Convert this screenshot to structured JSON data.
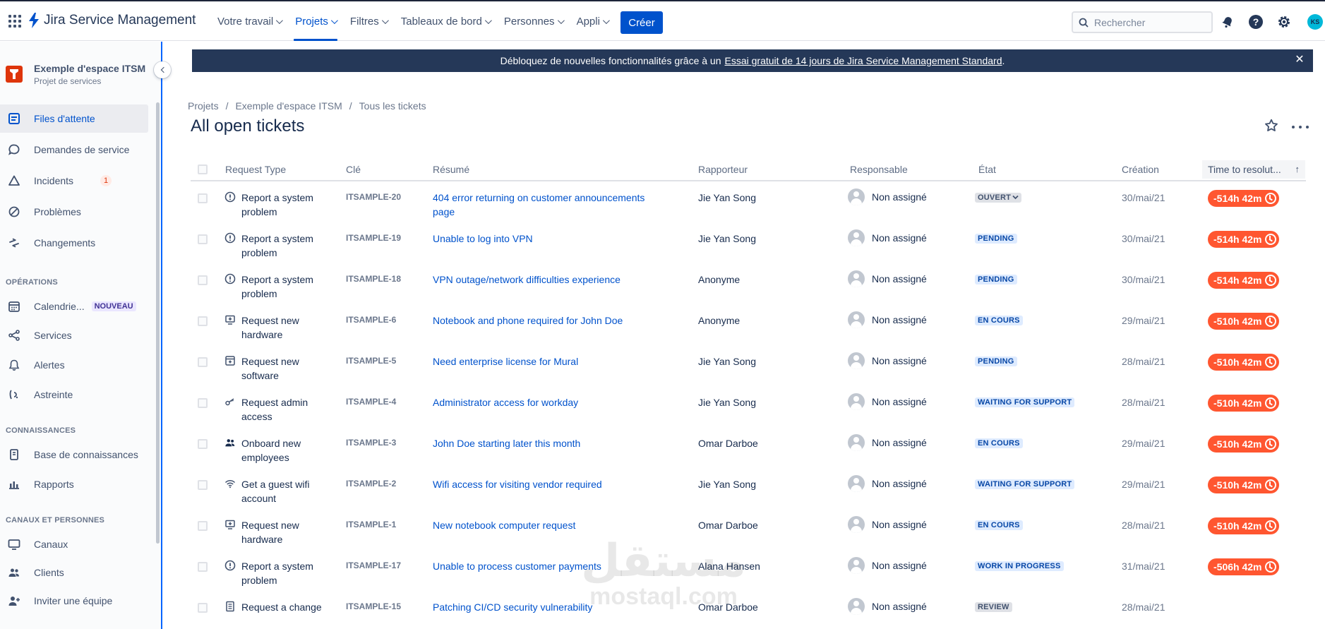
{
  "topnav": {
    "brand": "Jira Service Management",
    "menu": [
      {
        "label": "Votre travail",
        "active": false
      },
      {
        "label": "Projets",
        "active": true
      },
      {
        "label": "Filtres",
        "active": false
      },
      {
        "label": "Tableaux de bord",
        "active": false
      },
      {
        "label": "Personnes",
        "active": false
      },
      {
        "label": "Appli",
        "active": false
      }
    ],
    "create_label": "Créer",
    "search_placeholder": "Rechercher",
    "avatar_initials": "KS",
    "icons": [
      "app-switcher-icon",
      "notifications-icon",
      "help-icon",
      "settings-icon"
    ]
  },
  "sidebar": {
    "project_name": "Exemple d'espace ITSM",
    "project_type": "Projet de services",
    "items": [
      {
        "label": "Files d'attente",
        "icon": "queues-icon",
        "active": true
      },
      {
        "label": "Demandes de service",
        "icon": "chat-icon"
      },
      {
        "label": "Incidents",
        "icon": "warning-icon",
        "badge": "1"
      },
      {
        "label": "Problèmes",
        "icon": "prohibited-icon"
      },
      {
        "label": "Changements",
        "icon": "changes-icon"
      }
    ],
    "operations_title": "OPÉRATIONS",
    "operations": [
      {
        "label": "Calendrie...",
        "icon": "calendar-icon",
        "tag": "NOUVEAU"
      },
      {
        "label": "Services",
        "icon": "services-icon"
      },
      {
        "label": "Alertes",
        "icon": "bell-icon"
      },
      {
        "label": "Astreinte",
        "icon": "on-call-icon"
      }
    ],
    "knowledge_title": "CONNAISSANCES",
    "knowledge": [
      {
        "label": "Base de connaissances",
        "icon": "book-icon"
      },
      {
        "label": "Rapports",
        "icon": "chart-icon"
      }
    ],
    "channels_title": "CANAUX ET PERSONNES",
    "channels": [
      {
        "label": "Canaux",
        "icon": "monitor-icon"
      },
      {
        "label": "Clients",
        "icon": "people-icon"
      },
      {
        "label": "Inviter une équipe",
        "icon": "invite-icon"
      }
    ]
  },
  "banner": {
    "text": "Débloquez de nouvelles fonctionnalités grâce à un",
    "link": "Essai gratuit de 14 jours de Jira Service Management Standard",
    "suffix": "."
  },
  "breadcrumb": [
    "Projets",
    "Exemple d'espace ITSM",
    "Tous les tickets"
  ],
  "page_title": "All open tickets",
  "table": {
    "headers": {
      "request_type": "Request Type",
      "key": "Clé",
      "summary": "Résumé",
      "reporter": "Rapporteur",
      "assignee": "Responsable",
      "status": "État",
      "created": "Création",
      "sla": "Time to resolut...",
      "sort_arrow": "↑"
    },
    "rows": [
      {
        "type": "Report a system problem",
        "type_icon": "alert-circle-icon",
        "key": "ITSAMPLE-20",
        "summary": "404 error returning on customer announcements page",
        "reporter": "Jie Yan Song",
        "assignee": "Non assigné",
        "status": "OUVERT",
        "status_style": "open",
        "created": "30/mai/21",
        "sla": "-514h 42m"
      },
      {
        "type": "Report a system problem",
        "type_icon": "alert-circle-icon",
        "key": "ITSAMPLE-19",
        "summary": "Unable to log into VPN",
        "reporter": "Jie Yan Song",
        "assignee": "Non assigné",
        "status": "PENDING",
        "status_style": "blue",
        "created": "30/mai/21",
        "sla": "-514h 42m"
      },
      {
        "type": "Report a system problem",
        "type_icon": "alert-circle-icon",
        "key": "ITSAMPLE-18",
        "summary": "VPN outage/network difficulties experience",
        "reporter": "Anonyme",
        "assignee": "Non assigné",
        "status": "PENDING",
        "status_style": "blue",
        "created": "30/mai/21",
        "sla": "-514h 42m"
      },
      {
        "type": "Request new hardware",
        "type_icon": "hardware-icon",
        "key": "ITSAMPLE-6",
        "summary": "Notebook and phone required for John Doe",
        "reporter": "Anonyme",
        "assignee": "Non assigné",
        "status": "EN COURS",
        "status_style": "blue",
        "created": "29/mai/21",
        "sla": "-510h 42m"
      },
      {
        "type": "Request new software",
        "type_icon": "software-icon",
        "key": "ITSAMPLE-5",
        "summary": "Need enterprise license for Mural",
        "reporter": "Jie Yan Song",
        "assignee": "Non assigné",
        "status": "PENDING",
        "status_style": "blue",
        "created": "28/mai/21",
        "sla": "-510h 42m"
      },
      {
        "type": "Request admin access",
        "type_icon": "key-icon",
        "key": "ITSAMPLE-4",
        "summary": "Administrator access for workday",
        "reporter": "Jie Yan Song",
        "assignee": "Non assigné",
        "status": "WAITING FOR SUPPORT",
        "status_style": "blue",
        "created": "28/mai/21",
        "sla": "-510h 42m"
      },
      {
        "type": "Onboard new employees",
        "type_icon": "people-icon",
        "key": "ITSAMPLE-3",
        "summary": "John Doe starting later this month",
        "reporter": "Omar Darboe",
        "assignee": "Non assigné",
        "status": "EN COURS",
        "status_style": "blue",
        "created": "29/mai/21",
        "sla": "-510h 42m"
      },
      {
        "type": "Get a guest wifi account",
        "type_icon": "wifi-icon",
        "key": "ITSAMPLE-2",
        "summary": "Wifi access for visiting vendor required",
        "reporter": "Jie Yan Song",
        "assignee": "Non assigné",
        "status": "WAITING FOR SUPPORT",
        "status_style": "blue",
        "created": "29/mai/21",
        "sla": "-510h 42m"
      },
      {
        "type": "Request new hardware",
        "type_icon": "hardware-icon",
        "key": "ITSAMPLE-1",
        "summary": "New notebook computer request",
        "reporter": "Omar Darboe",
        "assignee": "Non assigné",
        "status": "EN COURS",
        "status_style": "blue",
        "created": "28/mai/21",
        "sla": "-510h 42m"
      },
      {
        "type": "Report a system problem",
        "type_icon": "alert-circle-icon",
        "key": "ITSAMPLE-17",
        "summary": "Unable to process customer payments",
        "reporter": "Alana Hansen",
        "assignee": "Non assigné",
        "status": "WORK IN PROGRESS",
        "status_style": "blue",
        "created": "31/mai/21",
        "sla": "-506h 42m"
      },
      {
        "type": "Request a change",
        "type_icon": "document-icon",
        "key": "ITSAMPLE-15",
        "summary": "Patching CI/CD security vulnerability",
        "reporter": "Omar Darboe",
        "assignee": "Non assigné",
        "status": "REVIEW",
        "status_style": "grey",
        "created": "28/mai/21",
        "sla": ""
      }
    ]
  },
  "watermark": {
    "arabic": "مستقل",
    "latin": "mostaql.com"
  },
  "colors": {
    "brand": "#0052CC",
    "sla_breached": "#FF5630",
    "banner": "#253858",
    "sidebar_bg": "#FAFBFC"
  }
}
